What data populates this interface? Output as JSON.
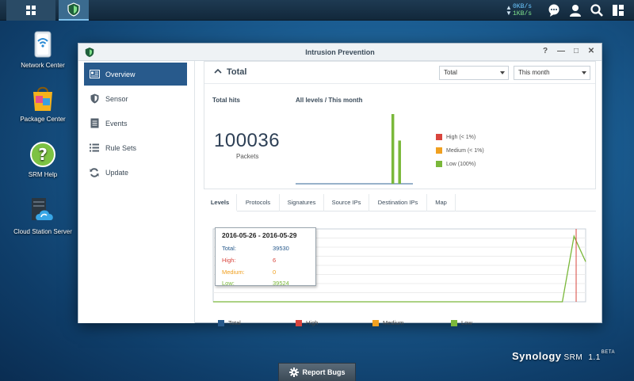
{
  "taskbar": {
    "net_up": "0KB/s",
    "net_down": "1KB/s"
  },
  "desktop": {
    "icons": [
      {
        "label": "Network Center"
      },
      {
        "label": "Package Center"
      },
      {
        "label": "SRM Help"
      },
      {
        "label": "Cloud Station Server"
      }
    ]
  },
  "window": {
    "title": "Intrusion Prevention",
    "controls": [
      "?",
      "—",
      "□",
      "✕"
    ]
  },
  "sidebar": {
    "items": [
      {
        "label": "Overview",
        "icon": "overview-icon",
        "active": true
      },
      {
        "label": "Sensor",
        "icon": "shield-icon"
      },
      {
        "label": "Events",
        "icon": "document-icon"
      },
      {
        "label": "Rule Sets",
        "icon": "list-icon"
      },
      {
        "label": "Update",
        "icon": "refresh-icon"
      }
    ]
  },
  "overview": {
    "section_title": "Total",
    "filter_select": "Total",
    "period_select": "This month",
    "total_hits_label": "Total hits",
    "levels_label": "All levels / This month",
    "total_hits_value": "100036",
    "total_hits_unit": "Packets",
    "legend": [
      {
        "label": "High (< 1%)",
        "color": "#d9453d"
      },
      {
        "label": "Medium (< 1%)",
        "color": "#f0a020"
      },
      {
        "label": "Low (100%)",
        "color": "#7ab83a"
      }
    ]
  },
  "tabs": [
    {
      "label": "Levels",
      "active": true
    },
    {
      "label": "Protocols"
    },
    {
      "label": "Signatures"
    },
    {
      "label": "Source IPs"
    },
    {
      "label": "Destination IPs"
    },
    {
      "label": "Map"
    }
  ],
  "tooltip": {
    "range": "2016-05-26 - 2016-05-29",
    "rows": [
      {
        "key": "Total:",
        "value": "39530",
        "color": "#285a8c"
      },
      {
        "key": "High:",
        "value": "6",
        "color": "#d9453d"
      },
      {
        "key": "Medium:",
        "value": "0",
        "color": "#f0a020"
      },
      {
        "key": "Low:",
        "value": "39524",
        "color": "#7ab83a"
      }
    ]
  },
  "levels_legend": [
    {
      "label": "Total",
      "color": "#285a8c"
    },
    {
      "label": "High",
      "color": "#d9453d"
    },
    {
      "label": "Medium",
      "color": "#f0a020"
    },
    {
      "label": "Low",
      "color": "#7ab83a"
    }
  ],
  "chart_data": [
    {
      "type": "bar",
      "title": "All levels / This month",
      "series": [
        {
          "name": "Low",
          "color": "#7ab83a",
          "values": [
            0,
            0,
            0,
            0,
            0,
            0,
            0,
            0,
            0,
            0,
            0,
            0,
            0,
            0,
            0,
            0,
            0,
            0,
            0,
            0,
            0,
            0,
            0,
            0,
            0,
            0,
            1.0,
            0,
            0.62,
            0
          ]
        }
      ],
      "ylim": [
        0,
        1
      ]
    },
    {
      "type": "line",
      "series": [
        {
          "name": "Low",
          "color": "#7ab83a",
          "values": [
            0,
            0,
            0,
            0,
            0,
            0,
            0,
            0,
            0,
            0,
            0,
            0,
            0,
            0,
            0,
            0,
            0,
            0,
            0,
            0,
            0,
            0,
            0,
            0,
            0,
            0,
            0,
            0,
            0,
            0,
            0,
            0.9,
            0.55
          ]
        }
      ],
      "highlight_index": 32,
      "ylim": [
        0,
        1
      ]
    }
  ],
  "report_bugs": "Report Bugs",
  "brand": {
    "name": "Synology",
    "product": "SRM",
    "version": "1.1",
    "tag": "BETA"
  }
}
